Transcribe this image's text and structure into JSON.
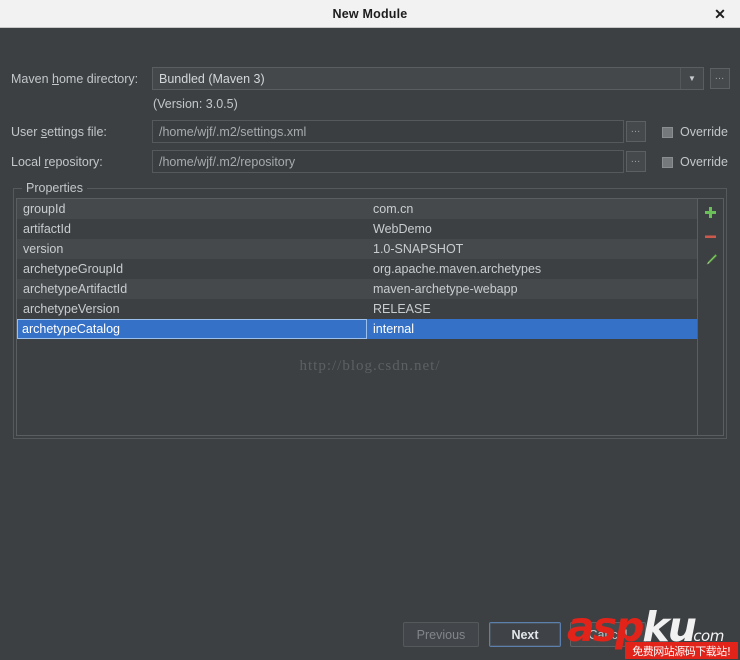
{
  "titlebar": {
    "title": "New Module",
    "close_label": "✕"
  },
  "form": {
    "maven_home": {
      "label_pre": "Maven ",
      "label_mnemonic": "h",
      "label_post": "ome directory:",
      "value": "Bundled (Maven 3)",
      "arrow": "▼",
      "browse_label": "…"
    },
    "version_line": "(Version: 3.0.5)",
    "user_settings": {
      "label_pre": "User ",
      "label_mnemonic": "s",
      "label_post": "ettings file:",
      "value": "/home/wjf/.m2/settings.xml",
      "browse_label": "…",
      "override_label": "Override",
      "override_checked": false
    },
    "local_repository": {
      "label_pre": "Local ",
      "label_mnemonic": "r",
      "label_post": "epository:",
      "value": "/home/wjf/.m2/repository",
      "browse_label": "…",
      "override_label": "Override",
      "override_checked": false
    }
  },
  "properties": {
    "legend": "Properties",
    "rows": [
      {
        "key": "groupId",
        "value": "com.cn"
      },
      {
        "key": "artifactId",
        "value": "WebDemo"
      },
      {
        "key": "version",
        "value": "1.0-SNAPSHOT"
      },
      {
        "key": "archetypeGroupId",
        "value": "org.apache.maven.archetypes"
      },
      {
        "key": "archetypeArtifactId",
        "value": "maven-archetype-webapp"
      },
      {
        "key": "archetypeVersion",
        "value": "RELEASE"
      },
      {
        "key": "archetypeCatalog",
        "value": "internal"
      }
    ],
    "selected_index": 6,
    "tools": {
      "add_label": "+",
      "remove_label": "−",
      "edit_label": "edit-pencil"
    },
    "colors": {
      "selection": "#3671c8",
      "add_icon": "#6bbf59",
      "remove_icon": "#cc5a4c",
      "edit_icon": "#77c15e"
    }
  },
  "watermark": {
    "text": "http://blog.csdn.net/"
  },
  "footer": {
    "previous_label": "Previous",
    "next_label": "Next",
    "cancel_label": "Cancel"
  },
  "logo": {
    "asp": "asp",
    "ku": "ku",
    "com": ".com",
    "banner": "免费网站源码下载站!",
    "red": "#e2231a"
  }
}
